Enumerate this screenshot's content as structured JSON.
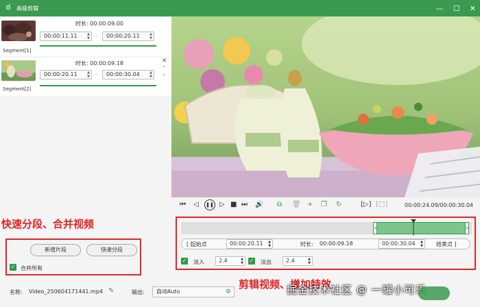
{
  "window": {
    "title": "高级剪辑",
    "logo_icon": "app-logo-icon"
  },
  "segments": [
    {
      "label": "Segment[1]",
      "duration_label": "时长:",
      "duration": "00:00:09.00",
      "start": "00:00:11.11",
      "end": "00:00:20.11"
    },
    {
      "label": "Segment[2]",
      "duration_label": "时长:",
      "duration": "00:00:09.18",
      "start": "00:00:20.11",
      "end": "00:00:30.04"
    }
  ],
  "separator": "-",
  "annotations": {
    "left": "快速分段、合并视频",
    "right": "剪辑视频、增加特效"
  },
  "buttons": {
    "add_segment": "新增片段",
    "quick_split": "快速分段"
  },
  "merge_all": {
    "label": "合并所有",
    "checked": true
  },
  "footer": {
    "name_label": "名称:",
    "filename": "Video_250604171441.mp4",
    "output_label": "输出:",
    "output_value": "自动Auto"
  },
  "player": {
    "time_display": "00:00:24.09/00:00:30.04"
  },
  "edit": {
    "start_btn": "[ 起始点",
    "start_value": "00:00:20.11",
    "duration_label": "时长:",
    "duration_value": "00:00:09.18",
    "end_value": "00:00:30.04",
    "end_btn": "结束点 ]",
    "fade_in_label": "淡入",
    "fade_in_value": "2.4",
    "fade_in_checked": true,
    "fade_out_label": "淡出",
    "fade_out_value": "2.4",
    "fade_out_checked": true,
    "selection_start": 0.66,
    "selection_end": 1.0,
    "playhead": 0.8
  },
  "watermark": "掘金技术社区 @ 一罐小可乐",
  "colors": {
    "accent": "#3a9a4f",
    "annotation": "#e02424"
  }
}
